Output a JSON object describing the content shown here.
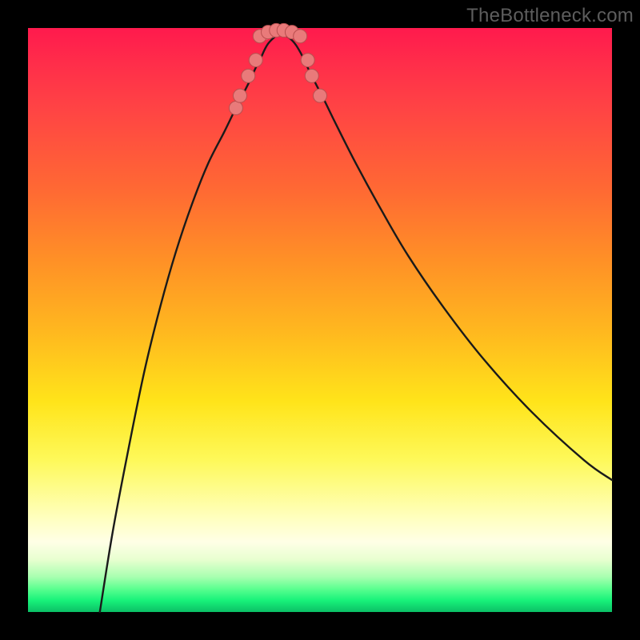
{
  "watermark": {
    "text": "TheBottleneck.com"
  },
  "colors": {
    "curve_stroke": "#1a1a1a",
    "marker_fill": "#e97a7a",
    "marker_stroke": "#b94f4f"
  },
  "chart_data": {
    "type": "line",
    "title": "",
    "xlabel": "",
    "ylabel": "",
    "xlim": [
      0,
      100
    ],
    "ylim": [
      0,
      100
    ],
    "grid": false,
    "note": "No axes, tick labels, or numeric data labels are rendered in the image; curve shapes and marker placements are estimated from pixel positions.",
    "series": [
      {
        "name": "left-curve",
        "path_norm": [
          [
            12.3,
            0.0
          ],
          [
            14.5,
            13.7
          ],
          [
            17.1,
            27.4
          ],
          [
            19.9,
            41.1
          ],
          [
            22.6,
            52.1
          ],
          [
            25.3,
            61.6
          ],
          [
            28.1,
            69.9
          ],
          [
            30.8,
            76.7
          ],
          [
            33.6,
            82.2
          ],
          [
            35.6,
            86.3
          ],
          [
            37.7,
            90.4
          ],
          [
            39.0,
            93.2
          ],
          [
            39.7,
            94.5
          ],
          [
            41.1,
            97.3
          ],
          [
            43.2,
            99.3
          ]
        ]
      },
      {
        "name": "right-curve",
        "path_norm": [
          [
            43.2,
            99.3
          ],
          [
            45.2,
            97.9
          ],
          [
            46.6,
            95.9
          ],
          [
            47.9,
            93.2
          ],
          [
            49.3,
            90.4
          ],
          [
            50.7,
            87.7
          ],
          [
            52.7,
            83.6
          ],
          [
            56.2,
            76.7
          ],
          [
            60.3,
            69.2
          ],
          [
            65.1,
            61.0
          ],
          [
            71.2,
            52.1
          ],
          [
            78.1,
            43.2
          ],
          [
            86.3,
            34.2
          ],
          [
            95.2,
            26.0
          ],
          [
            100.0,
            22.6
          ]
        ]
      },
      {
        "name": "valley-floor",
        "path_norm": [
          [
            39.7,
            98.6
          ],
          [
            41.8,
            99.3
          ],
          [
            43.2,
            99.6
          ],
          [
            45.2,
            99.3
          ],
          [
            46.6,
            98.6
          ]
        ]
      }
    ],
    "markers_norm": [
      [
        35.6,
        86.3
      ],
      [
        36.3,
        88.4
      ],
      [
        37.7,
        91.8
      ],
      [
        39.0,
        94.5
      ],
      [
        39.7,
        98.6
      ],
      [
        41.1,
        99.3
      ],
      [
        42.5,
        99.6
      ],
      [
        43.8,
        99.6
      ],
      [
        45.2,
        99.3
      ],
      [
        46.6,
        98.6
      ],
      [
        47.9,
        94.5
      ],
      [
        48.6,
        91.8
      ],
      [
        50.0,
        88.4
      ]
    ]
  }
}
